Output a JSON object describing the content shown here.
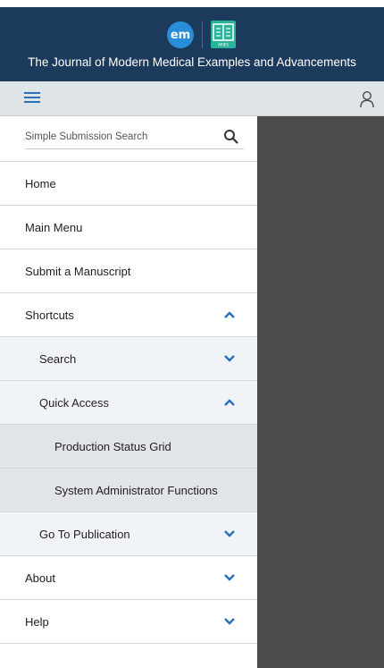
{
  "header": {
    "logo_text": "em",
    "aries_logo_text": "ARIES",
    "journal_title": "The Journal of Modern Medical Examples and Advancements"
  },
  "search": {
    "placeholder": "Simple Submission Search"
  },
  "nav": {
    "home": "Home",
    "main_menu": "Main Menu",
    "submit": "Submit a Manuscript",
    "shortcuts": "Shortcuts",
    "search": "Search",
    "quick_access": "Quick Access",
    "production_status_grid": "Production Status Grid",
    "system_admin": "System Administrator Functions",
    "go_to_publication": "Go To Publication",
    "about": "About",
    "help": "Help"
  },
  "colors": {
    "header_bg": "#1b3a5c",
    "accent": "#2a6fb8",
    "logo_em": "#2a8dd8",
    "logo_aries": "#27b49a"
  },
  "icons": {
    "menu": "hamburger-menu-icon",
    "user": "user-icon",
    "search": "search-icon",
    "expanded": "chevron-up-icon",
    "collapsed": "chevron-down-icon"
  }
}
